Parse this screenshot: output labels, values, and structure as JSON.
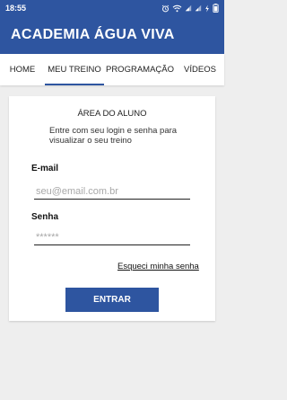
{
  "status_bar": {
    "time": "18:55",
    "icons": [
      "alarm-icon",
      "wifi-icon",
      "signal-icon",
      "signal-icon",
      "charging-icon",
      "battery-icon"
    ]
  },
  "app": {
    "title": "ACADEMIA ÁGUA VIVA",
    "accent_color": "#2e55a0"
  },
  "tabs": [
    {
      "label": "HOME",
      "active": false
    },
    {
      "label": "MEU TREINO",
      "active": true
    },
    {
      "label": "PROGRAMAÇÃO",
      "active": false
    },
    {
      "label": "VÍDEOS",
      "active": false
    }
  ],
  "login": {
    "title": "ÁREA DO ALUNO",
    "subtitle": "Entre com seu login e senha para visualizar o seu treino",
    "email_label": "E-mail",
    "email_placeholder": "seu@email.com.br",
    "password_label": "Senha",
    "password_placeholder": "******",
    "forgot_link": "Esqueci minha senha",
    "submit_label": "ENTRAR"
  }
}
